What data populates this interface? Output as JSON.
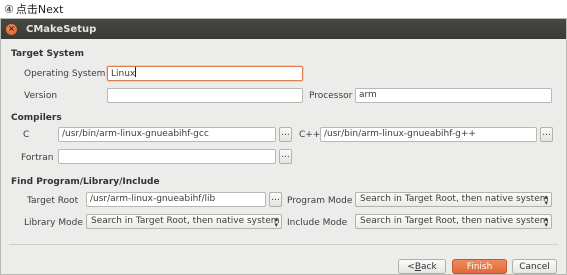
{
  "caption": {
    "step_number": "④",
    "text": "点击Next"
  },
  "window": {
    "title": "CMakeSetup",
    "close_glyph": "×"
  },
  "target_system": {
    "heading": "Target System",
    "os_label": "Operating System",
    "os_value": "Linux",
    "version_label": "Version",
    "version_value": "",
    "processor_label": "Processor",
    "processor_value": "arm"
  },
  "compilers": {
    "heading": "Compilers",
    "c_label": "C",
    "c_value": "/usr/bin/arm-linux-gnueabihf-gcc",
    "cxx_label": "C++",
    "cxx_value": "/usr/bin/arm-linux-gnueabihf-g++",
    "fortran_label": "Fortran",
    "fortran_value": "",
    "browse_label": "..."
  },
  "find": {
    "heading": "Find Program/Library/Include",
    "target_root_label": "Target Root",
    "target_root_value": "/usr/arm-linux-gnueabihf/lib",
    "program_mode_label": "Program Mode",
    "program_mode_value": "Search in Target Root, then native system",
    "library_mode_label": "Library Mode",
    "library_mode_value": "Search in Target Root, then native system",
    "include_mode_label": "Include Mode",
    "include_mode_value": "Search in Target Root, then native system"
  },
  "buttons": {
    "back_prefix": "< ",
    "back_mnemonic": "B",
    "back_rest": "ack",
    "finish": "Finish",
    "cancel": "Cancel"
  },
  "colors": {
    "accent": "#e06a3a",
    "titlebar": "#3a3935",
    "dialog_bg": "#ececea"
  }
}
